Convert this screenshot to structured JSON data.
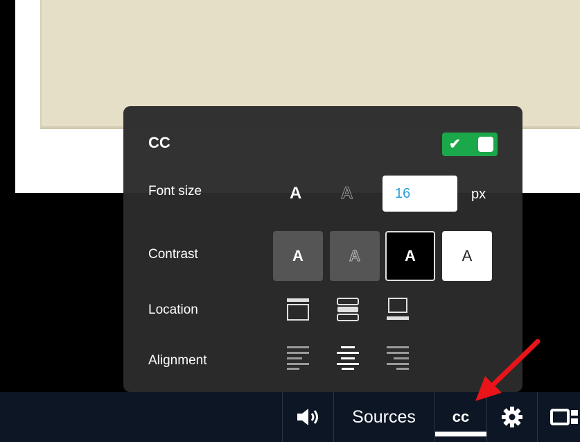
{
  "cc_panel": {
    "title": "CC",
    "toggle_check": "✔",
    "font_size_label": "Font size",
    "font_size_glyph_solid": "A",
    "font_size_glyph_outline": "A",
    "font_size_value": "16",
    "font_size_unit": "px",
    "contrast_label": "Contrast",
    "contrast_options": [
      "A",
      "A",
      "A",
      "A"
    ],
    "location_label": "Location",
    "alignment_label": "Alignment"
  },
  "controlbar": {
    "sources_label": "Sources",
    "cc_label": "cc"
  },
  "colors": {
    "toggle_on": "#1aa84a",
    "font_size_value": "#2a9fd8",
    "annotation_arrow": "#e8141a",
    "controlbar_bg": "#0c1624",
    "beige_card": "#e6dfc8"
  },
  "icons": [
    "volume-icon",
    "gear-icon",
    "picture-in-picture-icon",
    "location-top-icon",
    "location-middle-icon",
    "location-bottom-icon",
    "align-left-icon",
    "align-center-icon",
    "align-right-icon"
  ]
}
